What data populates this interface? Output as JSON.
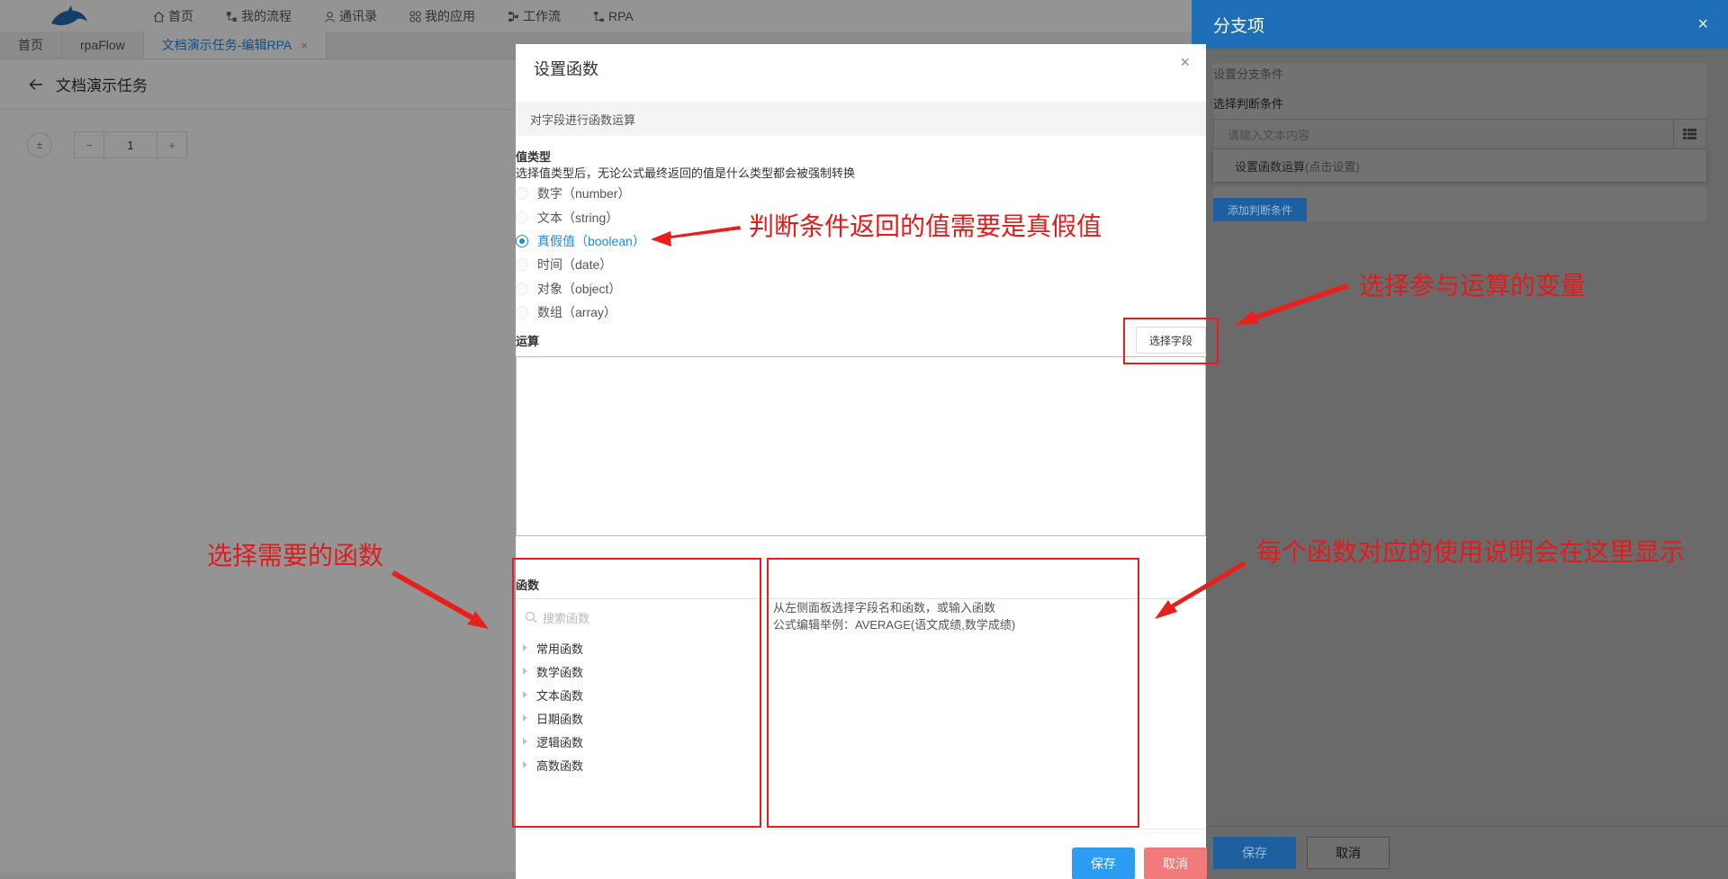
{
  "topnav": {
    "items": [
      {
        "label": "首页",
        "icon": "home-icon"
      },
      {
        "label": "我的流程",
        "icon": "flow-icon"
      },
      {
        "label": "通讯录",
        "icon": "contacts-icon"
      },
      {
        "label": "我的应用",
        "icon": "apps-icon"
      },
      {
        "label": "工作流",
        "icon": "workflow-icon"
      },
      {
        "label": "RPA",
        "icon": "rpa-icon"
      }
    ]
  },
  "tabs": [
    {
      "label": "首页"
    },
    {
      "label": "rpaFlow"
    },
    {
      "label": "文档演示任务-编辑RPA",
      "close": "×"
    }
  ],
  "page": {
    "title": "文档演示任务",
    "stepper": {
      "minus": "−",
      "value": "1",
      "plus": "+"
    }
  },
  "drawer": {
    "title": "分支项",
    "close": "×",
    "section_label": "设置分支条件",
    "condition_label": "选择判断条件",
    "input_placeholder": "请输入文本内容",
    "dropdown_item": "设置函数运算",
    "dropdown_hint": "(点击设置)",
    "add_button": "添加判断条件",
    "save_button": "保存",
    "cancel_button": "取消",
    "accent": "#1e6fb8"
  },
  "modal": {
    "title": "设置函数",
    "close": "×",
    "subtitle": "对字段进行函数运算",
    "value_type_title": "值类型",
    "value_type_desc": "选择值类型后，无论公式最终返回的值是什么类型都会被强制转换",
    "value_types": [
      {
        "label": "数字（number）",
        "checked": false
      },
      {
        "label": "文本（string）",
        "checked": false
      },
      {
        "label": "真假值（boolean）",
        "checked": true
      },
      {
        "label": "时间（date）",
        "checked": false
      },
      {
        "label": "对象（object）",
        "checked": false
      },
      {
        "label": "数组（array）",
        "checked": false
      }
    ],
    "operation_title": "运算",
    "pick_field_button": "选择字段",
    "functions_title": "函数",
    "search_placeholder": "搜索函数",
    "categories": [
      "常用函数",
      "数学函数",
      "文本函数",
      "日期函数",
      "逻辑函数",
      "高数函数"
    ],
    "help_line1": "从左侧面板选择字段名和函数，或输入函数",
    "help_line2": "公式编辑举例：AVERAGE(语文成绩,数学成绩)",
    "save_button": "保存",
    "cancel_button": "取消",
    "save_color": "#2d9cf3",
    "cancel_color": "#f17b7b",
    "accent": "#1e88e5"
  },
  "annotations": {
    "boolean_note": "判断条件返回的值需要是真假值",
    "field_note": "选择参与运算的变量",
    "function_note": "选择需要的函数",
    "help_note": "每个函数对应的使用说明会在这里显示",
    "color": "#e21b1b"
  }
}
